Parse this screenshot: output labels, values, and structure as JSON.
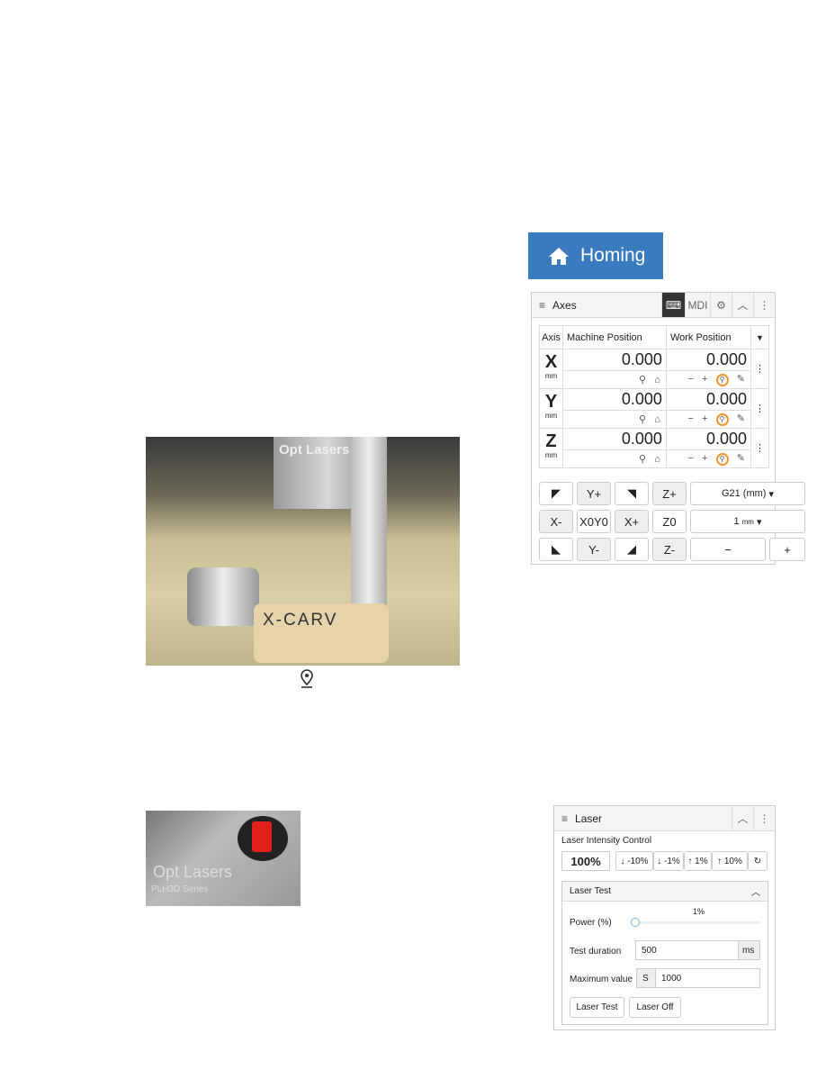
{
  "photo1": {
    "brand_text": "Opt Lasers",
    "workpiece_text": "X-CARV"
  },
  "pin_icon": "map-pin-icon",
  "photo2": {
    "brand_text": "Opt Lasers",
    "sub_text": "PLH3D Series"
  },
  "homing": {
    "label": "Homing",
    "icon": "home-icon",
    "color": "#3a7bbf"
  },
  "axes": {
    "title": "Axes",
    "tabs": [
      "MDI"
    ],
    "columns": [
      "Axis",
      "Machine Position",
      "Work Position"
    ],
    "rows": [
      {
        "axis": "X",
        "unit": "mm",
        "machine": "0.000",
        "work": "0.000"
      },
      {
        "axis": "Y",
        "unit": "mm",
        "machine": "0.000",
        "work": "0.000"
      },
      {
        "axis": "Z",
        "unit": "mm",
        "machine": "0.000",
        "work": "0.000"
      }
    ],
    "minus": "−",
    "plus": "+",
    "jog": {
      "yplus": "Y+",
      "zplus": "Z+",
      "units": "G21 (mm)",
      "xminus": "X-",
      "x0y0": "X0Y0",
      "xplus": "X+",
      "z0": "Z0",
      "step": "1",
      "step_unit": "mm",
      "yminus": "Y-",
      "zminus": "Z-",
      "dec": "−",
      "inc": "+"
    },
    "highlight_color": "#f0962c"
  },
  "laser": {
    "title": "Laser",
    "intensity_label": "Laser Intensity Control",
    "intensity": "100%",
    "adjust": [
      "↓ -10%",
      "↓ -1%",
      "↑ 1%",
      "↑ 10%",
      "↻"
    ],
    "test_title": "Laser Test",
    "power_label": "Power (%)",
    "power_value": "1%",
    "power": 1,
    "duration_label": "Test duration",
    "duration": "500",
    "duration_unit": "ms",
    "max_label": "Maximum value",
    "max_prefix": "S",
    "max": "1000",
    "test_button": "Laser Test",
    "off_button": "Laser Off"
  }
}
